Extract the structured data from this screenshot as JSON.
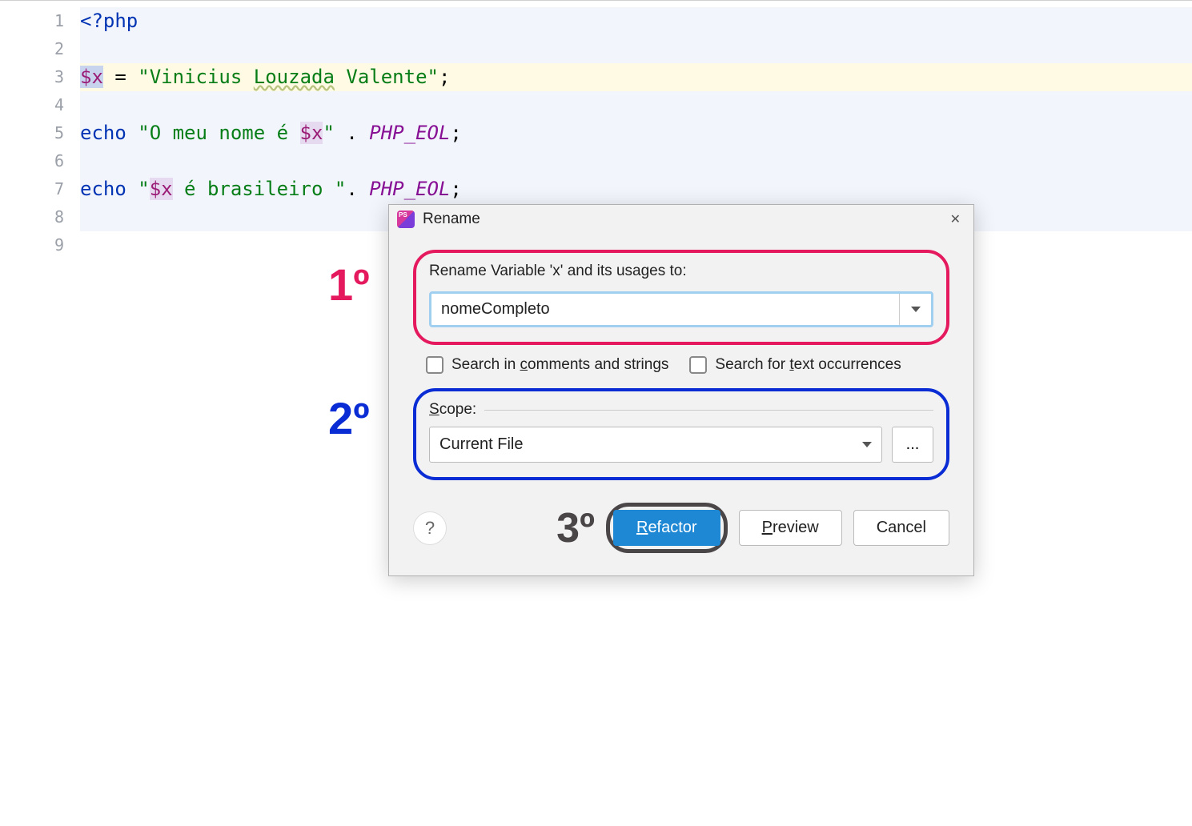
{
  "editor": {
    "gutter": [
      "1",
      "2",
      "3",
      "4",
      "5",
      "6",
      "7",
      "8",
      "9"
    ],
    "tokens": {
      "l1_open": "<?php",
      "l3_var": "$x",
      "l3_eq": " = ",
      "l3_q1": "\"",
      "l3_s1": "Vinicius ",
      "l3_s2": "Louzada",
      "l3_s3": " Valente",
      "l3_q2": "\"",
      "l3_semi": ";",
      "l5_echo": "echo ",
      "l5_q1": "\"",
      "l5_s1": "O meu nome é ",
      "l5_var": "$x",
      "l5_q2": "\"",
      "l5_dot": " . ",
      "l5_const": "PHP_EOL",
      "l5_semi": ";",
      "l7_echo": "echo ",
      "l7_q1": "\"",
      "l7_var": "$x",
      "l7_s1": " é brasileiro ",
      "l7_q2": "\"",
      "l7_dot": ". ",
      "l7_const": "PHP_EOL",
      "l7_semi": ";"
    }
  },
  "annotations": {
    "a1": "1º",
    "a2": "2º",
    "a3": "3º"
  },
  "dialog": {
    "title": "Rename",
    "rename_label": "Rename Variable 'x' and its usages to:",
    "rename_value": "nomeCompleto",
    "check1_pre": "Search in ",
    "check1_u": "c",
    "check1_post": "omments and strings",
    "check2_pre": "Search for ",
    "check2_u": "t",
    "check2_post": "ext occurrences",
    "scope_label_u": "S",
    "scope_label_post": "cope:",
    "scope_value": "Current File",
    "scope_more": "...",
    "help": "?",
    "btn_refactor_u": "R",
    "btn_refactor_post": "efactor",
    "btn_preview_u": "P",
    "btn_preview_post": "review",
    "btn_cancel": "Cancel"
  }
}
